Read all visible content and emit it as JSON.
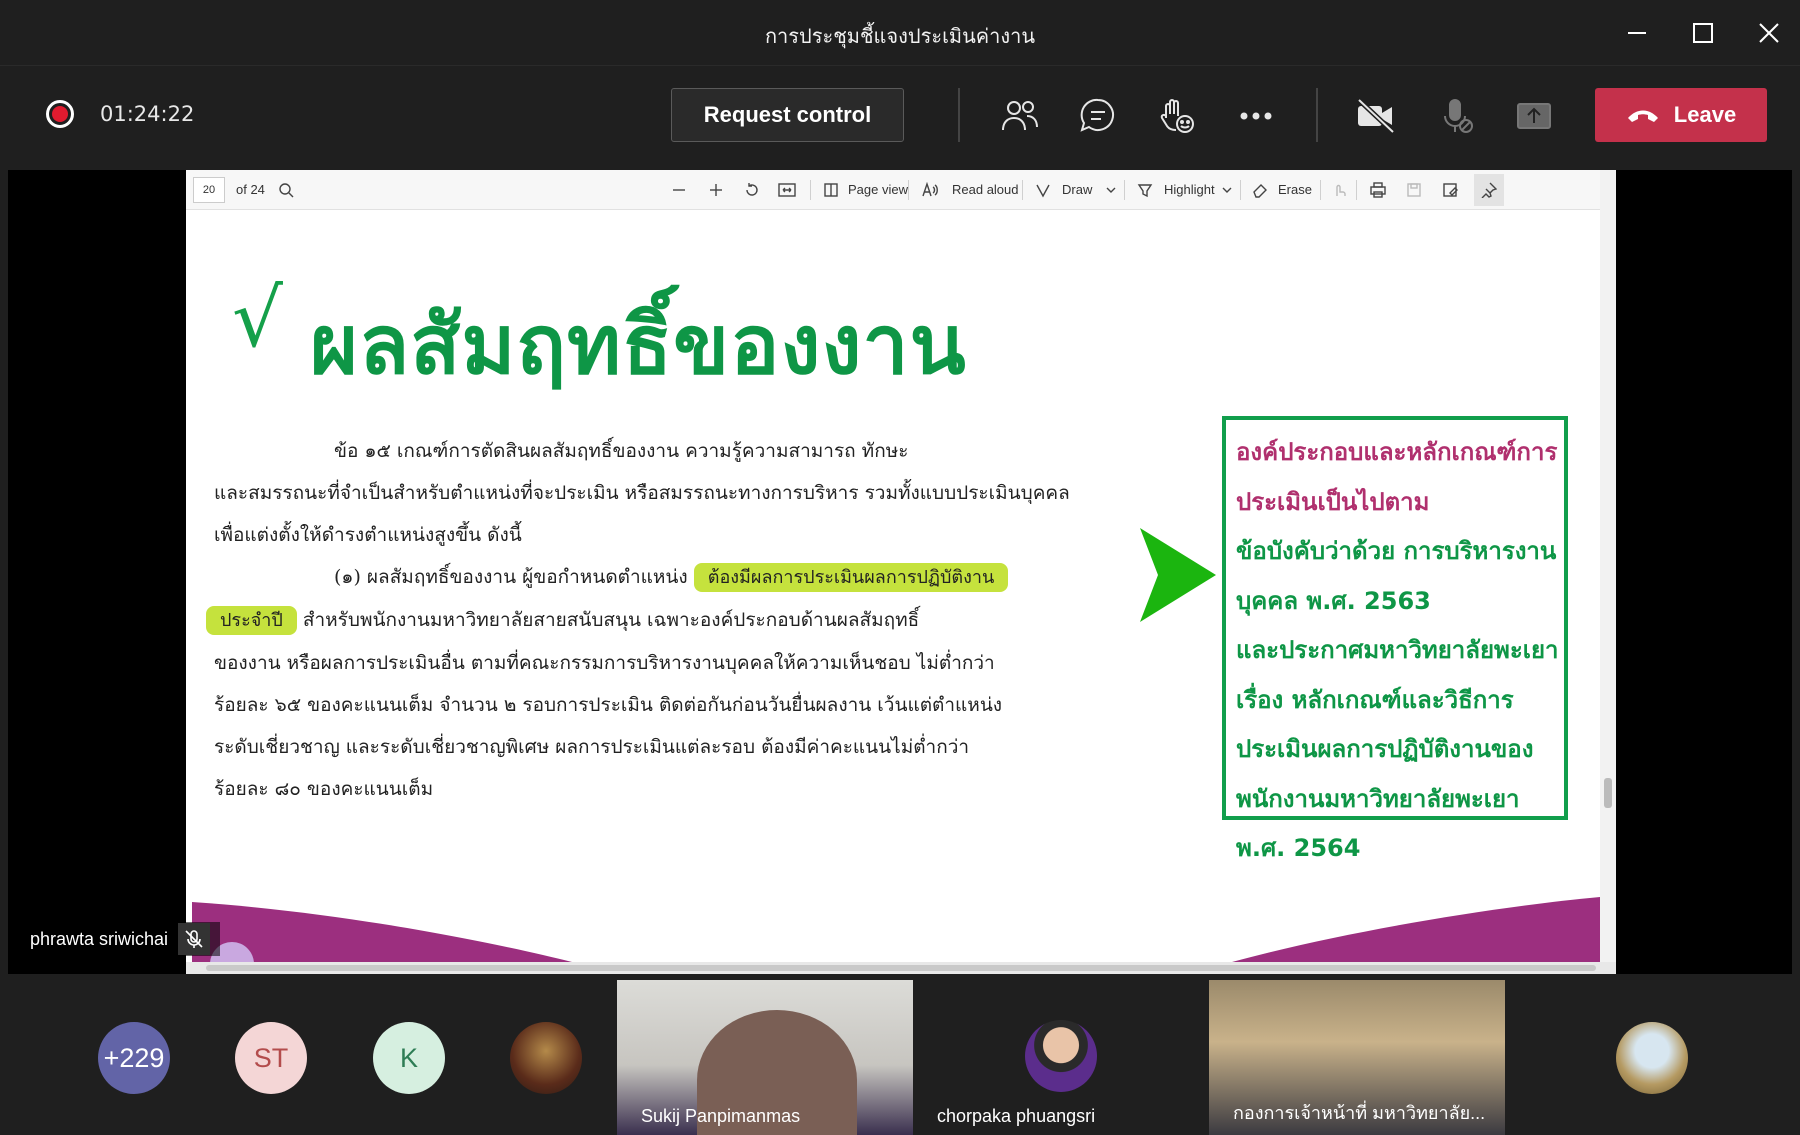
{
  "window": {
    "title": "การประชุมชี้แจงประเมินค่างาน"
  },
  "meeting": {
    "timer": "01:24:22",
    "request_control": "Request control",
    "leave": "Leave"
  },
  "pdf_toolbar": {
    "page_number": "20",
    "page_total": "of 24",
    "page_view": "Page view",
    "read_aloud": "Read aloud",
    "draw": "Draw",
    "highlight": "Highlight",
    "erase": "Erase"
  },
  "slide": {
    "checkmark": "√",
    "heading": "ผลสัมฤทธิ์ของงาน",
    "lines": [
      "ข้อ ๑๕ เกณฑ์การตัดสินผลสัมฤทธิ์ของงาน ความรู้ความสามารถ ทักษะ",
      "และสมรรถนะที่จำเป็นสำหรับตำแหน่งที่จะประเมิน หรือสมรรถนะทางการบริหาร รวมทั้งแบบประเมินบุคคล",
      "เพื่อแต่งตั้งให้ดำรงตำแหน่งสูงขึ้น ดังนี้"
    ],
    "line4_prefix": "(๑) ผลสัมฤทธิ์ของงาน ผู้ขอกำหนดตำแหน่ง",
    "highlight1": "ต้องมีผลการประเมินผลการปฏิบัติงาน",
    "highlight2": "ประจำปี",
    "line5_suffix": "สำหรับพนักงานมหาวิทยาลัยสายสนับสนุน เฉพาะองค์ประกอบด้านผลสัมฤทธิ์",
    "lines_rest": [
      "ของงาน หรือผลการประเมินอื่น ตามที่คณะกรรมการบริหารงานบุคคลให้ความเห็นชอบ ไม่ต่ำกว่า",
      "ร้อยละ ๖๕ ของคะแนนเต็ม จำนวน ๒ รอบการประเมิน ติดต่อกันก่อนวันยื่นผลงาน เว้นแต่ตำแหน่ง",
      "ระดับเชี่ยวชาญ และระดับเชี่ยวชาญพิเศษ ผลการประเมินแต่ละรอบ ต้องมีค่าคะแนนไม่ต่ำกว่า",
      "ร้อยละ ๘๐ ของคะแนนเต็ม"
    ],
    "box_lines_magenta": [
      "องค์ประกอบและหลักเกณฑ์การ",
      "ประเมินเป็นไปตาม"
    ],
    "box_lines_green": [
      "ข้อบังคับว่าด้วย การบริหารงาน",
      "บุคคล พ.ศ. 2563",
      "และประกาศมหาวิทยาลัยพะเยา",
      "เรื่อง หลักเกณฑ์และวิธีการ",
      "ประเมินผลการปฏิบัติงานของ",
      "พนักงานมหาวิทยาลัยพะเยา",
      "พ.ศ. 2564"
    ],
    "colors": {
      "green": "#0e9646",
      "magenta": "#b0306e",
      "highlight": "#c5e23d"
    }
  },
  "presenter": {
    "name": "phrawta sriwichai"
  },
  "participants": {
    "overflow": "+229",
    "st": "ST",
    "k": "K",
    "tile1": "Sukij Panpimanmas",
    "tile2": "chorpaka phuangsri",
    "tile3": "กองการเจ้าหน้าที่ มหาวิทยาลัย..."
  }
}
